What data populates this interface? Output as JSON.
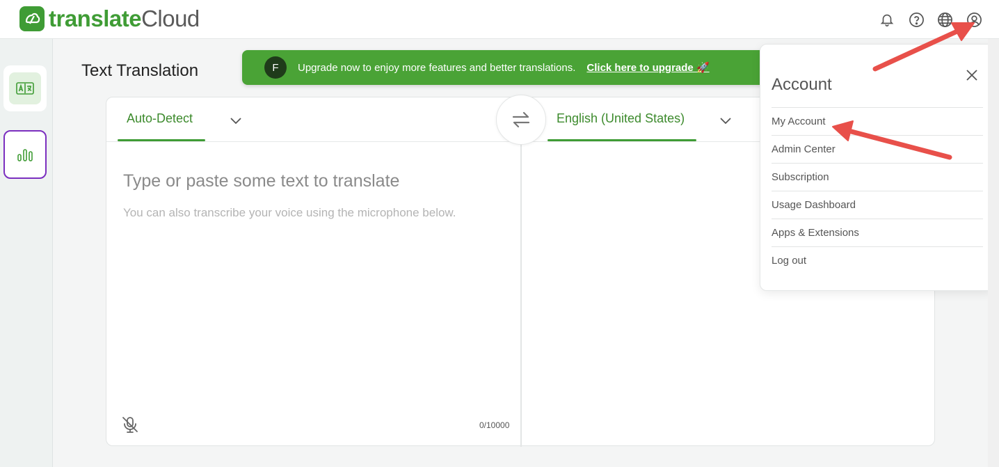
{
  "app": {
    "logo_part1": "translate",
    "logo_part2": "Cloud",
    "brand_color": "#3f9c35"
  },
  "header": {
    "icons": [
      "bell-icon",
      "help-icon",
      "globe-icon",
      "user-icon"
    ]
  },
  "page": {
    "title": "Text Translation"
  },
  "banner": {
    "avatar_letter": "F",
    "message": "Upgrade now to enjoy more features and better translations.",
    "link": "Click here to upgrade 🚀"
  },
  "translator": {
    "source_language": "Auto-Detect",
    "target_language": "English (United States)",
    "placeholder": "Type or paste some text to translate",
    "hint": "You can also transcribe your voice using the microphone below.",
    "char_count": "0/10000"
  },
  "account_menu": {
    "title": "Account",
    "items": [
      {
        "label": "My Account"
      },
      {
        "label": "Admin Center"
      },
      {
        "label": "Subscription"
      },
      {
        "label": "Usage Dashboard"
      },
      {
        "label": "Apps & Extensions"
      },
      {
        "label": "Log out"
      }
    ]
  },
  "annotation_color": "#e8504a"
}
